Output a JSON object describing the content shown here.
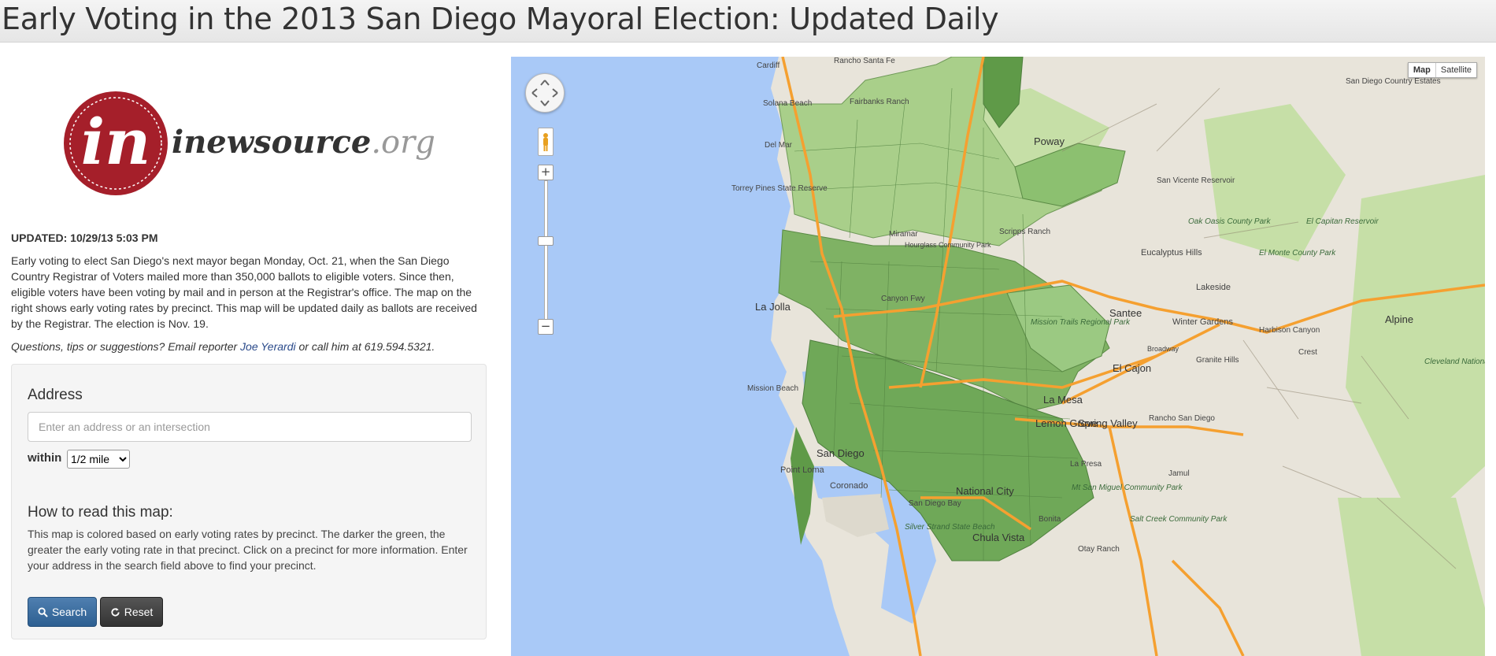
{
  "header": {
    "title": "Early Voting in the 2013 San Diego Mayoral Election: Updated Daily"
  },
  "logo": {
    "text_main": "inewsource",
    "text_tld": ".org",
    "mark": "in"
  },
  "intro": {
    "updated": "UPDATED: 10/29/13 5:03 PM",
    "body": "Early voting to elect San Diego's next mayor began Monday, Oct. 21, when the San Diego Country Registrar of Voters mailed more than 350,000 ballots to eligible voters. Since then, eligible voters have been voting by mail and in person at the Registrar's office. The map on the right shows early voting rates by precinct. This map will be updated daily as ballots are received by the Registrar. The election is Nov. 19.",
    "questions_prefix": "Questions, tips or suggestions? Email reporter ",
    "reporter_link": "Joe Yerardi",
    "questions_suffix": " or call him at 619.594.5321."
  },
  "search": {
    "address_label": "Address",
    "address_placeholder": "Enter an address or an intersection",
    "address_value": "",
    "within_label": "within",
    "within_selected": "1/2 mile",
    "search_button": "Search",
    "reset_button": "Reset"
  },
  "howto": {
    "title": "How to read this map:",
    "body": "This map is colored based on early voting rates by precinct. The darker the green, the greater the early voting rate in that precinct. Click on a precinct for more information. Enter your address in the search field above to find your precinct."
  },
  "map": {
    "type_active": "Map",
    "type_other": "Satellite",
    "zoom_in": "+",
    "zoom_out": "−",
    "colors": {
      "ocean": "#a9c9f7",
      "land": "#e8e4da",
      "park": "#c6dfa7",
      "precinct_light": "#a9cf8a",
      "precinct_dark": "#5f9a48",
      "freeway": "#f5a030"
    },
    "labels": {
      "cardiff": "Cardiff",
      "rancho_santa_fe": "Rancho Santa Fe",
      "solana_beach": "Solana Beach",
      "fairbanks_ranch": "Fairbanks Ranch",
      "del_mar": "Del Mar",
      "torrey_pines": "Torrey Pines State Reserve",
      "poway": "Poway",
      "san_diego_estates": "San Diego Country Estates",
      "san_vicente": "San Vicente Reservoir",
      "oak_oasis": "Oak Oasis County Park",
      "el_capitan": "El Capitan Reservoir",
      "el_monte": "El Monte County Park",
      "eucalyptus_hills": "Eucalyptus Hills",
      "lakeside": "Lakeside",
      "miramar": "Miramar",
      "scripps_ranch": "Scripps Ranch",
      "santee": "Santee",
      "winter_gardens": "Winter Gardens",
      "mission_trails": "Mission Trails Regional Park",
      "alpine": "Alpine",
      "harbison": "Harbison Canyon",
      "crest": "Crest",
      "cleveland": "Cleveland National Fore",
      "la_jolla": "La Jolla",
      "el_cajon": "El Cajon",
      "la_mesa": "La Mesa",
      "granite_hills": "Granite Hills",
      "rancho_sd": "Rancho San Diego",
      "lemon_grove": "Lemon Grove",
      "spring_valley": "Spring Valley",
      "jamul": "Jamul",
      "mission_beach": "Mission Beach",
      "san_diego": "San Diego",
      "point_loma": "Point Loma",
      "coronado": "Coronado",
      "sd_bay": "San Diego Bay",
      "national_city": "National City",
      "la_presa": "La Presa",
      "mt_san_miguel": "Mt San Miguel Community Park",
      "bonita": "Bonita",
      "salt_creek": "Salt Creek Community Park",
      "silver_strand": "Silver Strand State Beach",
      "chula_vista": "Chula Vista",
      "otay_ranch": "Otay Ranch",
      "canyon_fwy": "Canyon Fwy",
      "broadway": "Broadway",
      "hourglass": "Hourglass Community Park"
    }
  }
}
